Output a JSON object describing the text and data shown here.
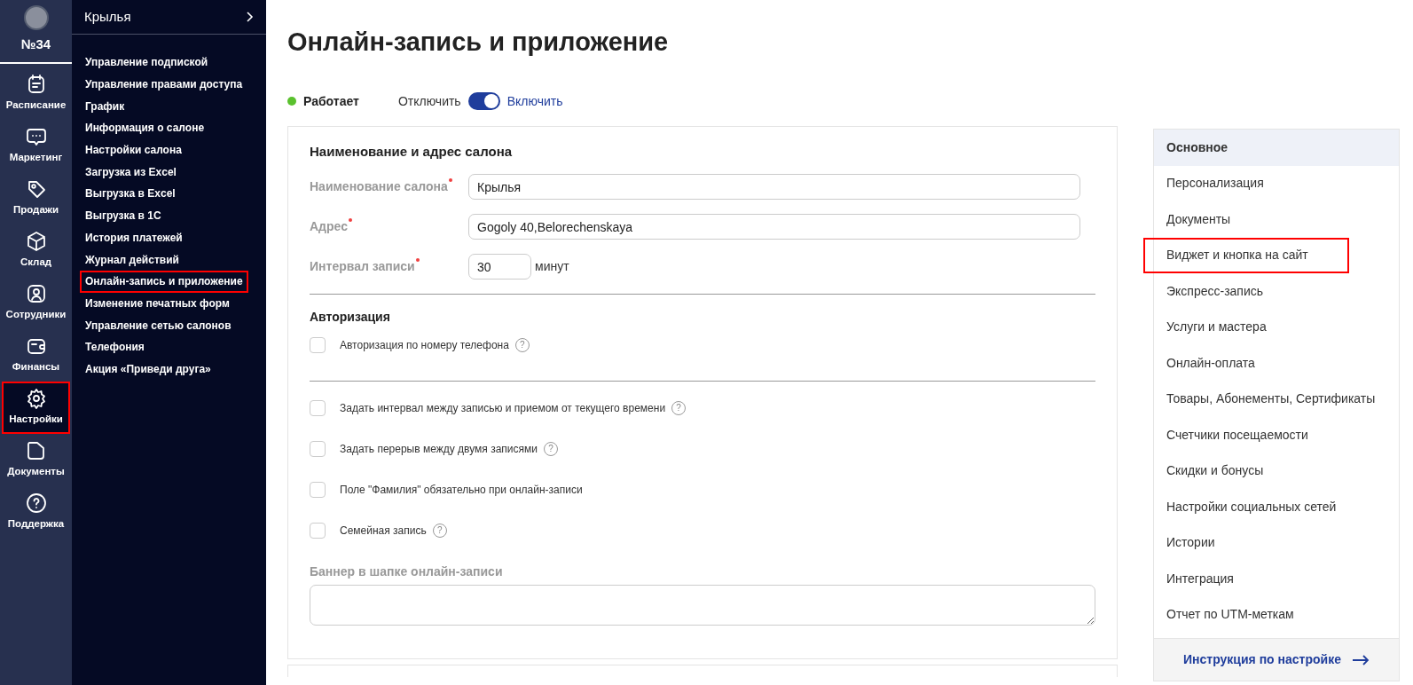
{
  "nav_rail": {
    "account": "№34",
    "items": [
      {
        "label": "Расписание",
        "selected": false,
        "highlighted": false
      },
      {
        "label": "Маркетинг",
        "selected": false,
        "highlighted": false
      },
      {
        "label": "Продажи",
        "selected": false,
        "highlighted": false
      },
      {
        "label": "Склад",
        "selected": false,
        "highlighted": false
      },
      {
        "label": "Сотрудники",
        "selected": false,
        "highlighted": false
      },
      {
        "label": "Финансы",
        "selected": false,
        "highlighted": false
      },
      {
        "label": "Настройки",
        "selected": true,
        "highlighted": true
      },
      {
        "label": "Документы",
        "selected": false,
        "highlighted": false
      },
      {
        "label": "Поддержка",
        "selected": false,
        "highlighted": false
      }
    ]
  },
  "submenu": {
    "title": "Крылья",
    "items": [
      {
        "label": "Управление подпиской",
        "highlighted": false
      },
      {
        "label": "Управление правами доступа",
        "highlighted": false
      },
      {
        "label": "График",
        "highlighted": false
      },
      {
        "label": "Информация о салоне",
        "highlighted": false
      },
      {
        "label": "Настройки салона",
        "highlighted": false
      },
      {
        "label": "Загрузка из Excel",
        "highlighted": false
      },
      {
        "label": "Выгрузка в Excel",
        "highlighted": false
      },
      {
        "label": "Выгрузка в 1С",
        "highlighted": false
      },
      {
        "label": "История платежей",
        "highlighted": false
      },
      {
        "label": "Журнал действий",
        "highlighted": false
      },
      {
        "label": "Онлайн-запись и приложение",
        "highlighted": true
      },
      {
        "label": "Изменение печатных форм",
        "highlighted": false
      },
      {
        "label": "Управление сетью салонов",
        "highlighted": false
      },
      {
        "label": "Телефония",
        "highlighted": false
      },
      {
        "label": "Акция «Приведи друга»",
        "highlighted": false
      }
    ]
  },
  "page_title": "Онлайн-запись и приложение",
  "status": {
    "label": "Работает",
    "off_label": "Отключить",
    "on_label": "Включить",
    "on": true
  },
  "form": {
    "section_title": "Наименование и адрес салона",
    "fields": [
      {
        "label": "Наименование салона",
        "value": "Крылья",
        "required": true,
        "kind": "wide"
      },
      {
        "label": "Адрес",
        "value": "Gogoly 40,Belorechenskaya",
        "required": true,
        "kind": "wide"
      },
      {
        "label": "Интервал записи",
        "value": "30",
        "unit": "минут",
        "required": true,
        "kind": "short"
      }
    ],
    "auth_title": "Авторизация",
    "auth_options": [
      {
        "label": "Авторизация по номеру телефона",
        "checked": false,
        "help": "?"
      }
    ],
    "options": [
      {
        "label": "Задать интервал между записью и приемом от текущего времени",
        "checked": false,
        "help": "?"
      },
      {
        "label": "Задать перерыв между двумя записями",
        "checked": false,
        "help": "?"
      },
      {
        "label": "Поле \"Фамилия\" обязательно при онлайн-записи",
        "checked": false
      },
      {
        "label": "Семейная запись",
        "checked": false,
        "help": "?"
      }
    ],
    "banner_label": "Баннер в шапке онлайн-записи"
  },
  "section_menu": {
    "items": [
      {
        "label": "Основное",
        "selected": true,
        "highlighted": false
      },
      {
        "label": "Персонализация",
        "selected": false,
        "highlighted": false
      },
      {
        "label": "Документы",
        "selected": false,
        "highlighted": false
      },
      {
        "label": "Виджет и кнопка на сайт",
        "selected": false,
        "highlighted": true
      },
      {
        "label": "Экспресс-запись",
        "selected": false,
        "highlighted": false
      },
      {
        "label": "Услуги и мастера",
        "selected": false,
        "highlighted": false
      },
      {
        "label": "Онлайн-оплата",
        "selected": false,
        "highlighted": false
      },
      {
        "label": "Товары, Абонементы, Сертификаты",
        "selected": false,
        "highlighted": false
      },
      {
        "label": "Счетчики посещаемости",
        "selected": false,
        "highlighted": false
      },
      {
        "label": "Скидки и бонусы",
        "selected": false,
        "highlighted": false
      },
      {
        "label": "Настройки социальных сетей",
        "selected": false,
        "highlighted": false
      },
      {
        "label": "Истории",
        "selected": false,
        "highlighted": false
      },
      {
        "label": "Интеграция",
        "selected": false,
        "highlighted": false
      },
      {
        "label": "Отчет по UTM-меткам",
        "selected": false,
        "highlighted": false
      }
    ],
    "footer_link": "Инструкция по настройке"
  }
}
